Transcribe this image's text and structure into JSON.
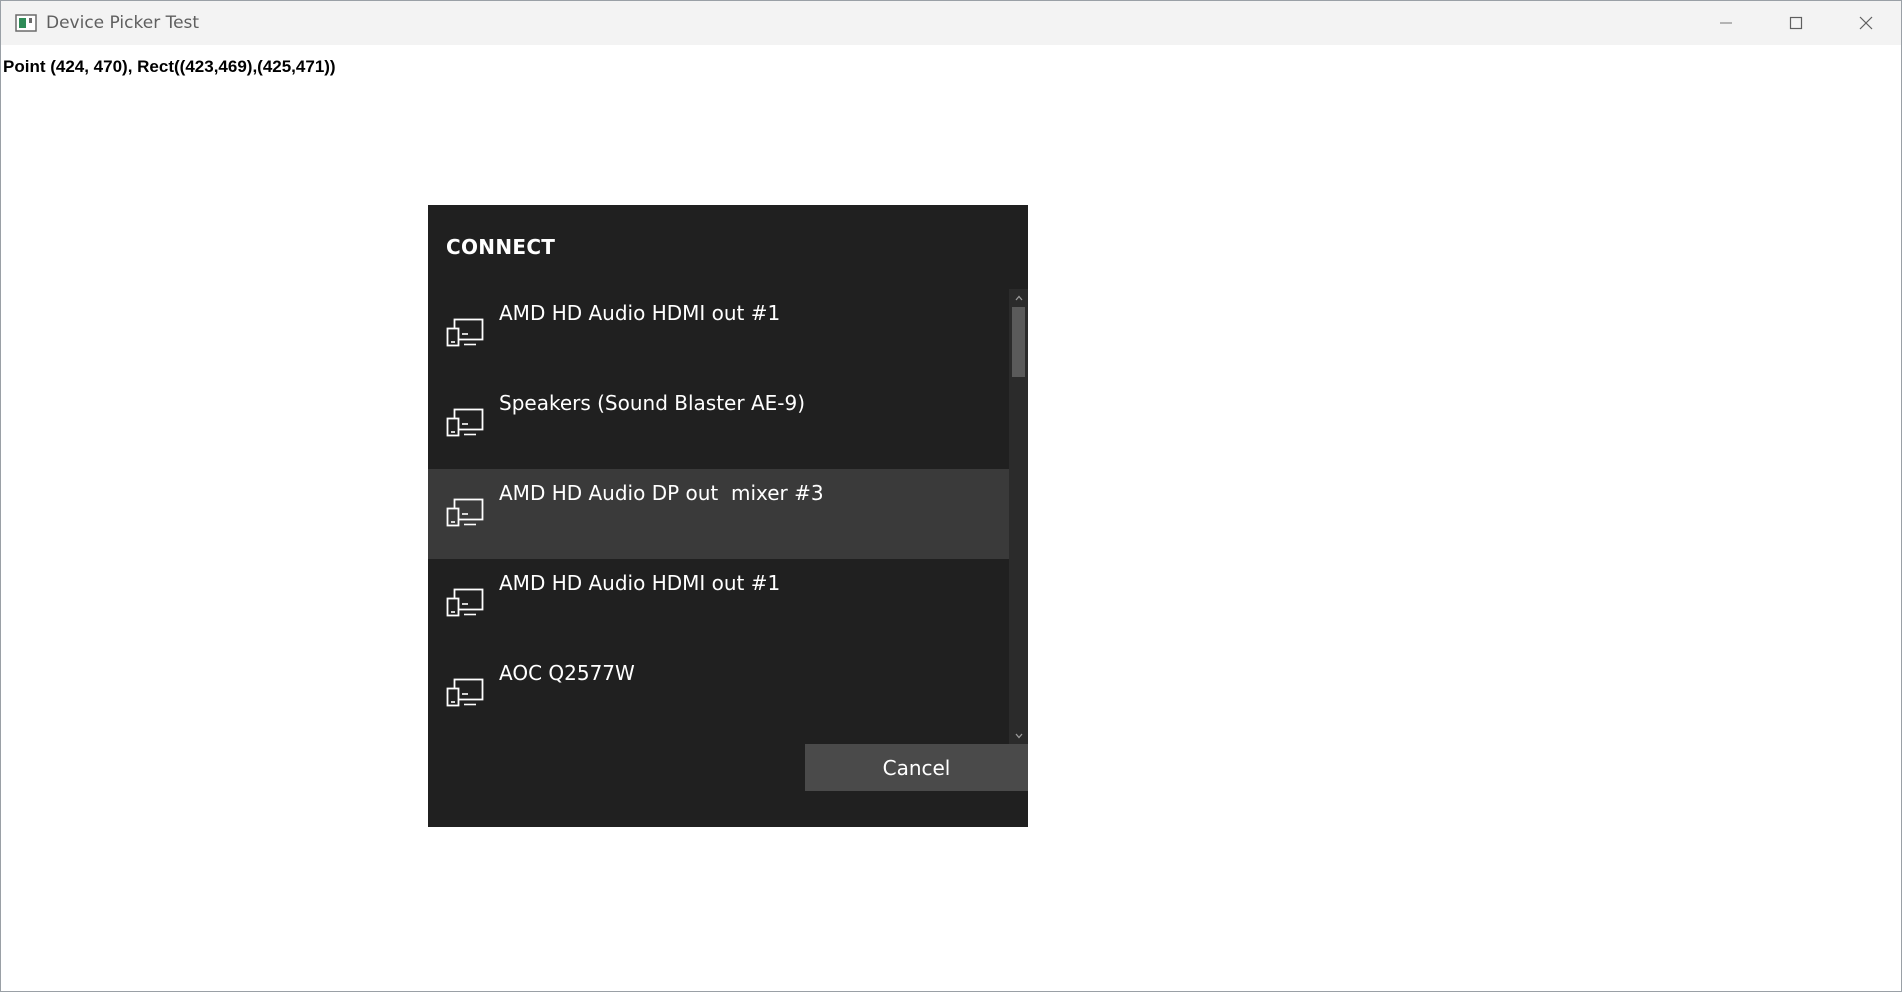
{
  "window": {
    "title": "Device Picker Test",
    "icon": "app-window-icon",
    "controls": [
      "minimize-icon",
      "maximize-icon",
      "close-icon"
    ]
  },
  "content": {
    "coords_text": "Point (424, 470), Rect((423,469),(425,471))"
  },
  "picker": {
    "title": "CONNECT",
    "devices": [
      {
        "label": "AMD HD Audio HDMI out #1",
        "icon": "device-icon",
        "hovered": false
      },
      {
        "label": "Speakers (Sound Blaster AE-9)",
        "icon": "device-icon",
        "hovered": false
      },
      {
        "label": "AMD HD Audio DP out  mixer #3",
        "icon": "device-icon",
        "hovered": true
      },
      {
        "label": "AMD HD Audio HDMI out #1",
        "icon": "device-icon",
        "hovered": false
      },
      {
        "label": "AOC Q2577W",
        "icon": "device-icon",
        "hovered": false
      }
    ],
    "cancel_label": "Cancel",
    "colors": {
      "background": "#202020",
      "hover": "#3a3a3a",
      "button": "#4a4a4a",
      "text": "#ffffff"
    }
  }
}
